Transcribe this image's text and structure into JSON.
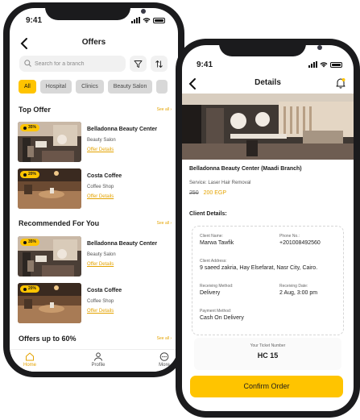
{
  "colors": {
    "accent": "#ffc400",
    "link": "#e4a300",
    "chip_bg": "#d8d8d8"
  },
  "offers_screen": {
    "status_time": "9:41",
    "header_title": "Offers",
    "search_placeholder": "Search for a branch",
    "filters": [
      "All",
      "Hospital",
      "Clinics",
      "Beauty Salon"
    ],
    "top_offer": {
      "title": "Top Offer",
      "see_all": "See all ›",
      "cards": [
        {
          "badge": "35%",
          "name": "Belladonna Beauty Center",
          "category": "Beauty Salon",
          "link": "Offer Details"
        },
        {
          "badge": "20%",
          "name": "Costa Coffee",
          "category": "Coffee Shop",
          "link": "Offer Details"
        }
      ]
    },
    "recommended": {
      "title": "Recommended For You",
      "see_all": "See all ›",
      "cards": [
        {
          "badge": "35%",
          "name": "Belladonna Beauty Center",
          "category": "Beauty Salon",
          "link": "Offer Details"
        },
        {
          "badge": "20%",
          "name": "Costa Coffee",
          "category": "Coffee Shop",
          "link": "Offer Details"
        }
      ]
    },
    "offers_60": {
      "title": "Offers up to 60%",
      "see_all": "See all ›"
    },
    "tabs": [
      "Home",
      "Profile",
      "More"
    ]
  },
  "details_screen": {
    "status_time": "9:41",
    "header_title": "Details",
    "branch_title": "Belladonna Beauty Center (Maadi Branch)",
    "service": "Service: Laser Hair Removal",
    "old_price": "250",
    "new_price": "200 EGP",
    "client_section": "Client Details:",
    "client": {
      "name_label": "Client Name:",
      "name": "Marwa Tawfik",
      "phone_label": "Phone No.:",
      "phone": "+201008492560",
      "address_label": "Client Address:",
      "address": "9 saeed zakria, Hay Elsefarat, Nasr City, Cairo.",
      "receiving_method_label": "Receiving Method:",
      "receiving_method": "Delivery",
      "receiving_date_label": "Receiving Date:",
      "receiving_date": "2 Aug, 3:00 pm",
      "payment_label": "Payment Method:",
      "payment": "Cash On Delivery"
    },
    "ticket_label": "Your Ticket Number",
    "ticket_number": "HC 15",
    "confirm_label": "Confirm Order"
  }
}
